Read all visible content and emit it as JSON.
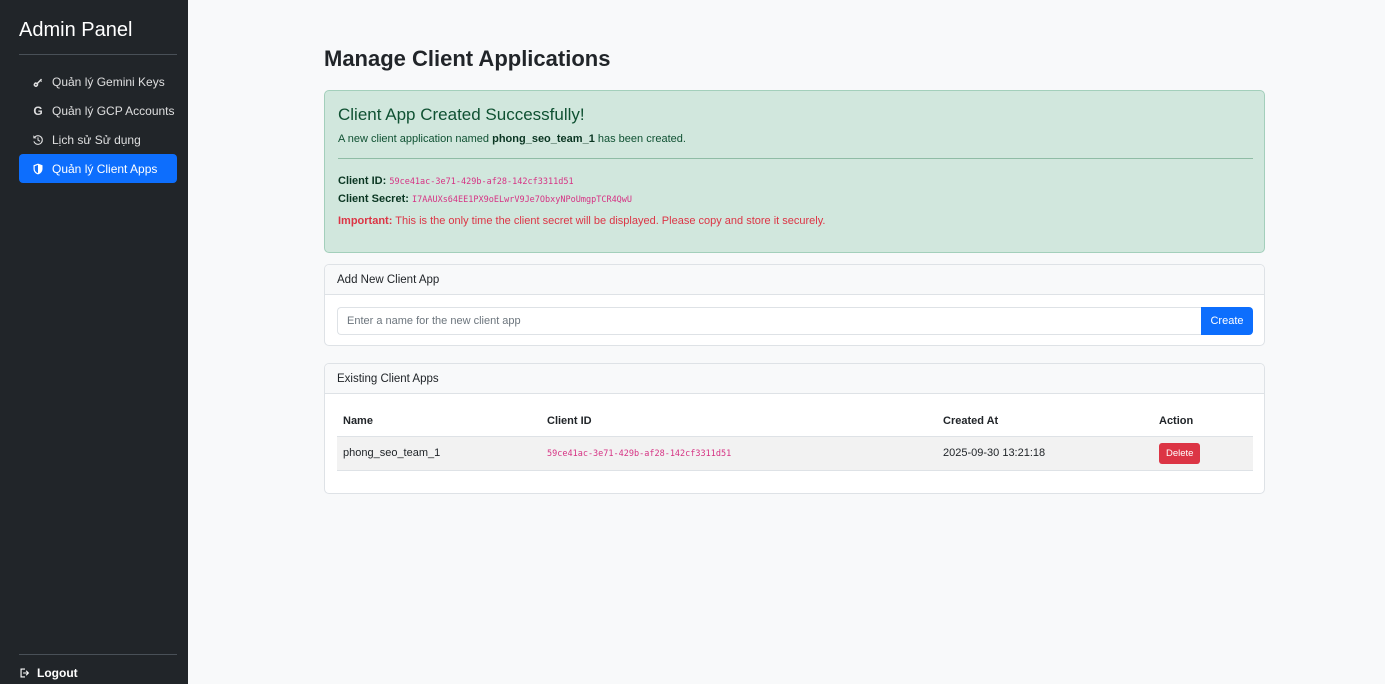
{
  "sidebar": {
    "title": "Admin Panel",
    "items": [
      {
        "label": "Quản lý Gemini Keys",
        "icon": "key-icon"
      },
      {
        "label": "Quản lý GCP Accounts",
        "icon": "google-icon"
      },
      {
        "label": "Lịch sử Sử dụng",
        "icon": "history-icon"
      },
      {
        "label": "Quản lý Client Apps",
        "icon": "shield-icon",
        "active": true
      }
    ],
    "logout": "Logout"
  },
  "page": {
    "title": "Manage Client Applications"
  },
  "alert": {
    "heading": "Client App Created Successfully!",
    "message_prefix": "A new client application named",
    "app_name": "phong_seo_team_1",
    "message_suffix": "has been created.",
    "client_id_label": "Client ID:",
    "client_id": "59ce41ac-3e71-429b-af28-142cf3311d51",
    "client_secret_label": "Client Secret:",
    "client_secret": "I7AAUXs64EE1PX9oELwrV9Je7ObxyNPoUmgpTCR4QwU",
    "important_label": "Important:",
    "important_text": "This is the only time the client secret will be displayed. Please copy and store it securely.",
    "color": "#d1e7dd"
  },
  "add_form": {
    "header": "Add New Client App",
    "placeholder": "Enter a name for the new client app",
    "value": "",
    "button": "Create"
  },
  "list": {
    "header": "Existing Client Apps",
    "columns": [
      "Name",
      "Client ID",
      "Created At",
      "Action"
    ],
    "rows": [
      {
        "name": "phong_seo_team_1",
        "client_id": "59ce41ac-3e71-429b-af28-142cf3311d51",
        "created_at": "2025-09-30 13:21:18",
        "action": "Delete"
      }
    ]
  },
  "colors": {
    "sidebar_bg": "#212529",
    "primary": "#0d6efd",
    "danger": "#dc3545",
    "success_bg": "#d1e7dd",
    "code": "#d63384"
  }
}
